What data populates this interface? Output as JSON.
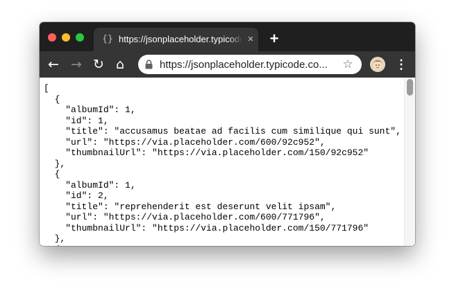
{
  "tab": {
    "title": "https://jsonplaceholder.typicode.com/photos",
    "favicon": "page-icon",
    "close": "×"
  },
  "new_tab": "+",
  "nav": {
    "back": "←",
    "forward": "→",
    "reload": "↻",
    "home": "⌂"
  },
  "omnibox": {
    "url": "https://jsonplaceholder.typicode.co...",
    "bookmark": "☆"
  },
  "menu": "⋮",
  "json_lines": [
    "[",
    "  {",
    "    \"albumId\": 1,",
    "    \"id\": 1,",
    "    \"title\": \"accusamus beatae ad facilis cum similique qui sunt\",",
    "    \"url\": \"https://via.placeholder.com/600/92c952\",",
    "    \"thumbnailUrl\": \"https://via.placeholder.com/150/92c952\"",
    "  },",
    "  {",
    "    \"albumId\": 1,",
    "    \"id\": 2,",
    "    \"title\": \"reprehenderit est deserunt velit ipsam\",",
    "    \"url\": \"https://via.placeholder.com/600/771796\",",
    "    \"thumbnailUrl\": \"https://via.placeholder.com/150/771796\"",
    "  },",
    "  {"
  ]
}
